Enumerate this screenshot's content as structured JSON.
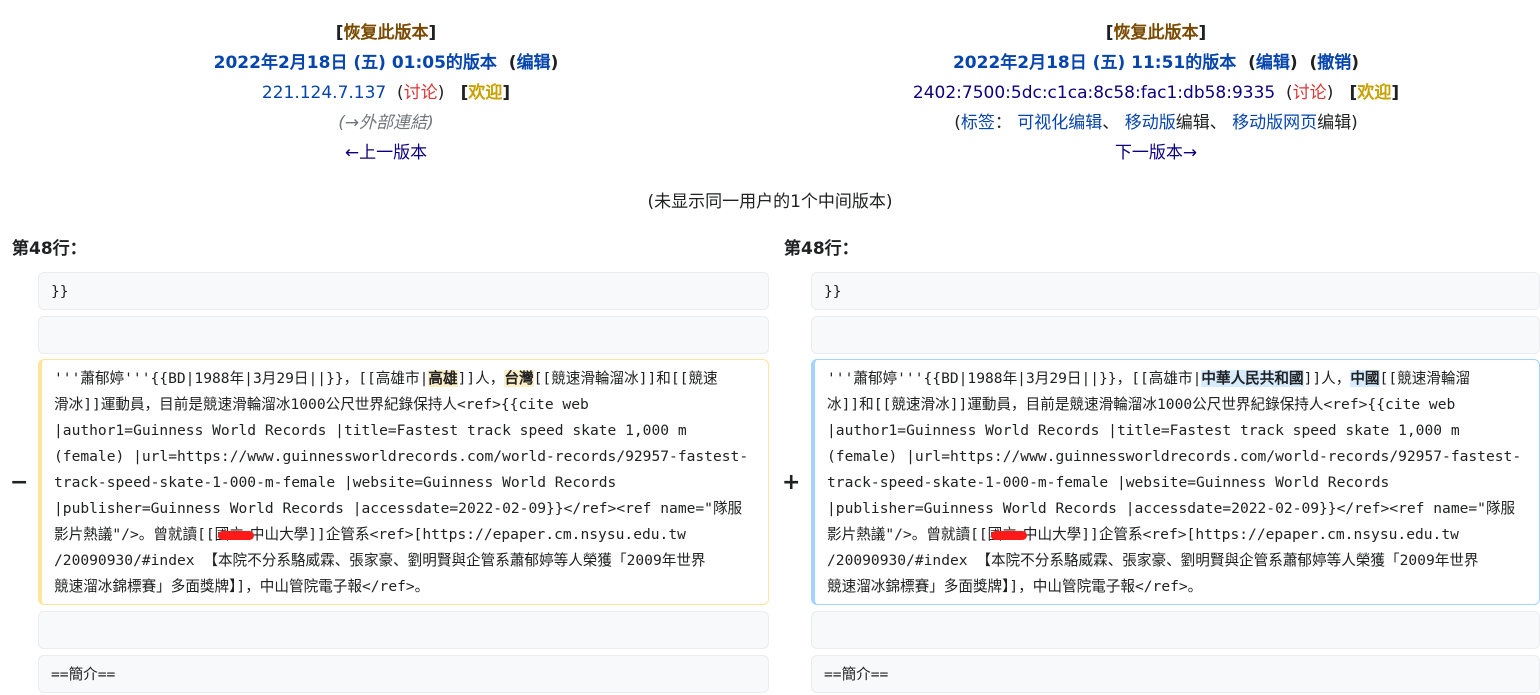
{
  "left": {
    "restore_label": "恢复此版本",
    "version_label": "2022年2月18日 (五) 01:05的版本",
    "edit_label": "编辑",
    "user_ip": "221.124.7.137",
    "talk_label": "讨论",
    "welcome_label": "欢迎",
    "summary": "(→外部連結)",
    "prev_label": "←上一版本"
  },
  "right": {
    "restore_label": "恢复此版本",
    "version_label": "2022年2月18日 (五) 11:51的版本",
    "edit_label": "编辑",
    "undo_label": "撤销",
    "user_ip": "2402:7500:5dc:c1ca:8c58:fac1:db58:9335",
    "talk_label": "讨论",
    "welcome_label": "欢迎",
    "tags_label": "标签",
    "tag1": "可视化编辑",
    "tag2": "移动版",
    "tag2_suffix": "编辑",
    "tag3": "移动版网页",
    "tag3_suffix": "编辑",
    "next_label": "下一版本→"
  },
  "middle_note": "(未显示同一用户的1个中间版本)",
  "left_line_no": "第48行：",
  "right_line_no": "第48行：",
  "context_top": "}}",
  "context_empty": "",
  "context_bottom": "==簡介==",
  "deleted": {
    "marker": "−",
    "l1a": "'''蕭郁婷'''{{BD|1988年|3月29日||}}，[[高雄市|",
    "l1h1": "高雄",
    "l1b": "]]人，",
    "l1h2": "台灣",
    "l1c": "[[競速滑輪溜冰]]和[[競速",
    "l2": "滑冰]]運動員，目前是競速滑輪溜冰1000公尺世界紀錄保持人<ref>{{cite web",
    "l3": "|author1=Guinness World Records |title=Fastest track speed skate 1,000 m",
    "l4": "(female) |url=https://www.guinnessworldrecords.com/world-records/92957-fastest-",
    "l5": "track-speed-skate-1-000-m-female |website=Guinness World Records",
    "l6": "|publisher=Guinness World Records |accessdate=2022-02-09}}</ref><ref name=\"隊服",
    "l7a": "影片熱議\"/>。曾就讀[[國立",
    "l7b": "中山大學]]企管系<ref>[https://epaper.cm.nsysu.edu.tw",
    "l8": "/20090930/#index 【本院不分系駱威霖、張家豪、劉明賢與企管系蕭郁婷等人榮獲「2009年世界",
    "l9": "競速溜冰錦標賽」多面獎牌】]，中山管院電子報</ref>。"
  },
  "added": {
    "marker": "+",
    "l1a": "'''蕭郁婷'''{{BD|1988年|3月29日||}}，[[高雄市|",
    "l1h1": "中華人民共和國",
    "l1b": "]]人，",
    "l1h2": "中國",
    "l1c": "[[競速滑輪溜",
    "l2": "冰]]和[[競速滑冰]]運動員，目前是競速滑輪溜冰1000公尺世界紀錄保持人<ref>{{cite web",
    "l3": "|author1=Guinness World Records |title=Fastest track speed skate 1,000 m",
    "l4": "(female) |url=https://www.guinnessworldrecords.com/world-records/92957-fastest-",
    "l5": "track-speed-skate-1-000-m-female |website=Guinness World Records",
    "l6": "|publisher=Guinness World Records |accessdate=2022-02-09}}</ref><ref name=\"隊服",
    "l7a": "影片熱議\"/>。曾就讀[[國立",
    "l7b": "中山大學]]企管系<ref>[https://epaper.cm.nsysu.edu.tw",
    "l8": "/20090930/#index 【本院不分系駱威霖、張家豪、劉明賢與企管系蕭郁婷等人榮獲「2009年世界",
    "l9": "競速溜冰錦標賽」多面獎牌】]，中山管院電子報</ref>。"
  },
  "colors": {
    "link": "#0645ad",
    "visited": "#0b0080",
    "red_link": "#d33",
    "del_border": "#ffe49c",
    "add_border": "#a3d3ff"
  }
}
